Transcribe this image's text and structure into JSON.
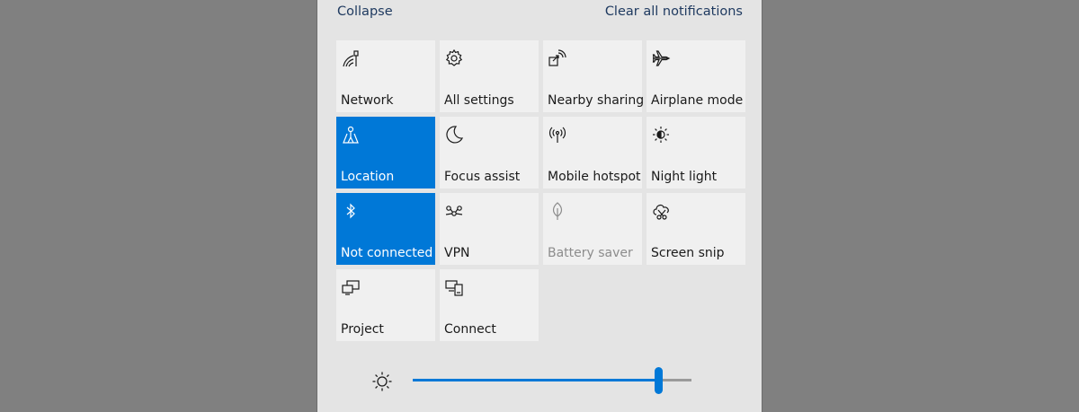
{
  "header": {
    "collapse_label": "Collapse",
    "clear_label": "Clear all notifications"
  },
  "tiles": [
    {
      "label": "Network",
      "icon": "network-icon",
      "state": "normal"
    },
    {
      "label": "All settings",
      "icon": "gear-icon",
      "state": "normal"
    },
    {
      "label": "Nearby sharing",
      "icon": "nearby-sharing-icon",
      "state": "normal"
    },
    {
      "label": "Airplane mode",
      "icon": "airplane-icon",
      "state": "normal"
    },
    {
      "label": "Location",
      "icon": "location-icon",
      "state": "active"
    },
    {
      "label": "Focus assist",
      "icon": "moon-icon",
      "state": "normal"
    },
    {
      "label": "Mobile hotspot",
      "icon": "hotspot-icon",
      "state": "normal"
    },
    {
      "label": "Night light",
      "icon": "night-light-icon",
      "state": "normal"
    },
    {
      "label": "Not connected",
      "icon": "bluetooth-icon",
      "state": "active"
    },
    {
      "label": "VPN",
      "icon": "vpn-icon",
      "state": "normal"
    },
    {
      "label": "Battery saver",
      "icon": "leaf-icon",
      "state": "disabled"
    },
    {
      "label": "Screen snip",
      "icon": "screen-snip-icon",
      "state": "normal"
    },
    {
      "label": "Project",
      "icon": "project-icon",
      "state": "normal"
    },
    {
      "label": "Connect",
      "icon": "connect-icon",
      "state": "normal"
    }
  ],
  "brightness": {
    "icon": "sun-icon",
    "level_percent": 88
  },
  "colors": {
    "accent": "#0078d7",
    "tile_bg": "#f0f0f0",
    "panel_bg": "#e4e4e4",
    "backdrop": "#808080"
  }
}
